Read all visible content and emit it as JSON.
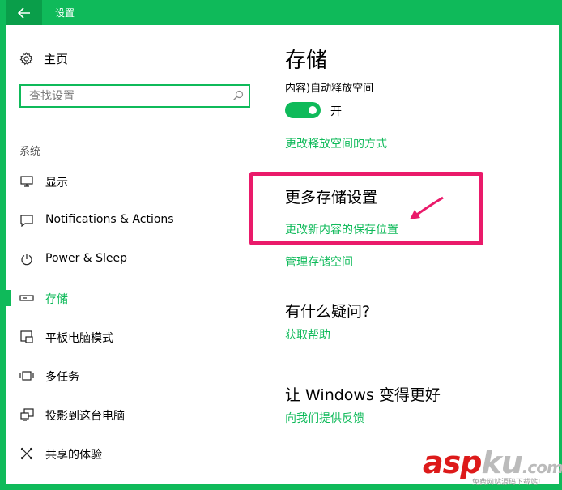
{
  "window": {
    "title": "设置"
  },
  "sidebar": {
    "home_label": "主页",
    "search_placeholder": "查找设置",
    "section_label": "系统",
    "items": [
      {
        "label": "显示",
        "icon": "monitor-icon"
      },
      {
        "label": "Notifications & Actions",
        "icon": "notification-icon"
      },
      {
        "label": "Power & Sleep",
        "icon": "power-icon"
      },
      {
        "label": "存储",
        "icon": "storage-icon",
        "active": true
      },
      {
        "label": "平板电脑模式",
        "icon": "tablet-mode-icon"
      },
      {
        "label": "多任务",
        "icon": "multitasking-icon"
      },
      {
        "label": "投影到这台电脑",
        "icon": "project-icon"
      },
      {
        "label": "共享的体验",
        "icon": "shared-experience-icon"
      }
    ]
  },
  "main": {
    "title": "存储",
    "storage_sense_label": "内容)自动释放空间",
    "toggle_state": "开",
    "toggle_on": true,
    "change_free_space_link": "更改释放空间的方式",
    "more_settings_heading": "更多存储设置",
    "change_save_location_link": "更改新内容的保存位置",
    "manage_spaces_link": "管理存储空间",
    "questions_heading": "有什么疑问?",
    "get_help_link": "获取帮助",
    "feedback_heading": "让 Windows 变得更好",
    "feedback_link": "向我们提供反馈"
  },
  "watermark": {
    "brand_a": "asp",
    "brand_b": "ku",
    "brand_c": ".com",
    "sub": "免费网站源码下载站!"
  },
  "colors": {
    "accent": "#0fba5a",
    "highlight": "#ea1a6a"
  }
}
